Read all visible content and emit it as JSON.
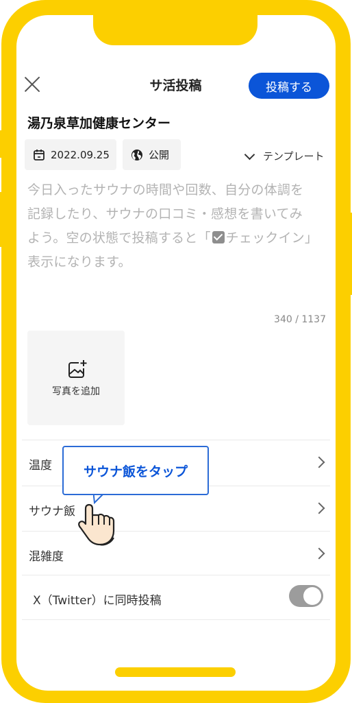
{
  "header": {
    "title": "サ活投稿",
    "post_button": "投稿する"
  },
  "facility_name": "湯乃泉草加健康センター",
  "meta": {
    "date": "2022.09.25",
    "visibility": "公開",
    "template": "テンプレート"
  },
  "textarea": {
    "placeholder_part1": "今日入ったサウナの時間や回数、自分の体調を記録したり、サウナの口コミ・感想を書いてみよう。空の状態で投稿すると「",
    "placeholder_part2": "チェックイン」表示になります。",
    "counter": "340 / 1137"
  },
  "photo": {
    "label": "写真を追加"
  },
  "rows": [
    {
      "label": "温度"
    },
    {
      "label": "サウナ飯"
    },
    {
      "label": "混雑度"
    },
    {
      "label": "X（Twitter）に同時投稿"
    }
  ],
  "callout": {
    "text": "サウナ飯をタップ"
  },
  "colors": {
    "frame": "#FCCF00",
    "accent": "#0B55D8"
  }
}
